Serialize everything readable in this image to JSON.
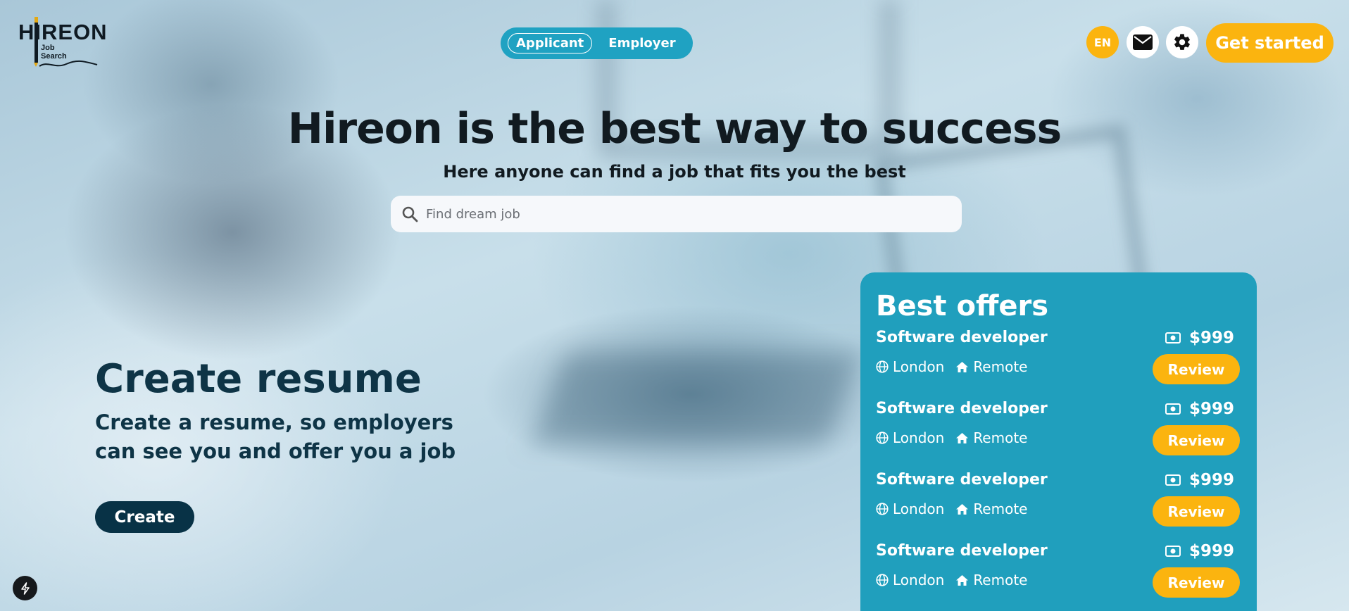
{
  "logo": {
    "word": "HIREON",
    "sub_line1": "Job",
    "sub_line2": "Search"
  },
  "role_toggle": {
    "applicant_label": "Applicant",
    "employer_label": "Employer",
    "active": "Applicant"
  },
  "header": {
    "language_label": "EN",
    "mail_icon": "envelope-icon",
    "settings_icon": "gear-icon",
    "get_started_label": "Get started"
  },
  "hero": {
    "title": "Hireon is the best way to success",
    "subtitle": "Here anyone can find a job that fits you the best",
    "search_placeholder": "Find dream job"
  },
  "resume": {
    "title": "Create resume",
    "description": "Create a resume, so employers can see you and offer you a job",
    "button_label": "Create"
  },
  "offers": {
    "title": "Best offers",
    "items": [
      {
        "title": "Software developer",
        "salary": "$999",
        "location": "London",
        "work_mode": "Remote",
        "button_label": "Review"
      },
      {
        "title": "Software developer",
        "salary": "$999",
        "location": "London",
        "work_mode": "Remote",
        "button_label": "Review"
      },
      {
        "title": "Software developer",
        "salary": "$999",
        "location": "London",
        "work_mode": "Remote",
        "button_label": "Review"
      },
      {
        "title": "Software developer",
        "salary": "$999",
        "location": "London",
        "work_mode": "Remote",
        "button_label": "Review"
      }
    ]
  },
  "colors": {
    "accent": "#fbb40f",
    "teal": "#209fbd",
    "dark": "#083246"
  },
  "dev_indicator_icon": "bolt-icon"
}
